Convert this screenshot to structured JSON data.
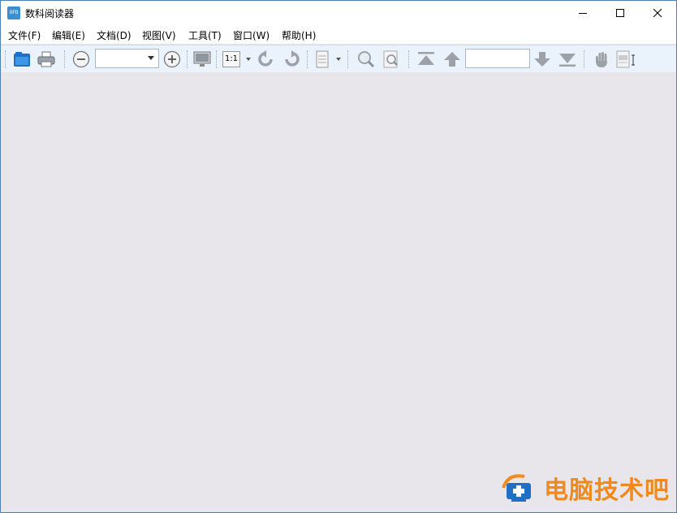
{
  "window": {
    "title": "数科阅读器",
    "app_icon_text": "OFD",
    "controls": {
      "minimize": "—",
      "maximize": "☐",
      "close": "✕"
    }
  },
  "menu": [
    {
      "label": "文件(F)"
    },
    {
      "label": "编辑(E)"
    },
    {
      "label": "文档(D)"
    },
    {
      "label": "视图(V)"
    },
    {
      "label": "工具(T)"
    },
    {
      "label": "窗口(W)"
    },
    {
      "label": "帮助(H)"
    }
  ],
  "toolbar": {
    "zoom_value": "",
    "actual_size_label": "1:1",
    "page_number_value": ""
  },
  "watermark": {
    "text": "电脑技术吧",
    "colors": {
      "text": "#f08a1e",
      "icon": "#1f6fc2"
    }
  },
  "colors": {
    "toolbar_bg": "#eaf2fc",
    "workspace_bg": "#e8e6ea",
    "accent": "#3a8fd3"
  }
}
